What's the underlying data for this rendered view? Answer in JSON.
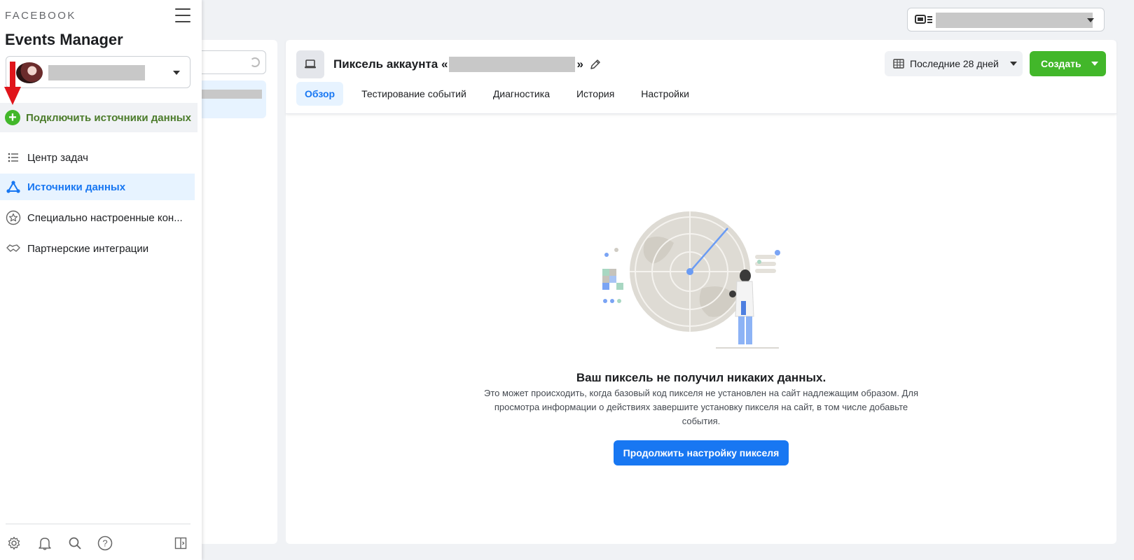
{
  "sidebar": {
    "brand": "FACEBOOK",
    "app_title": "Events Manager",
    "connect_label": "Подключить источники данных",
    "nav": [
      {
        "label": "Центр задач",
        "icon": "list-icon"
      },
      {
        "label": "Источники данных",
        "icon": "data-sources-icon",
        "active": true
      },
      {
        "label": "Специально настроенные кон...",
        "icon": "star-badge-icon"
      },
      {
        "label": "Партнерские интеграции",
        "icon": "handshake-icon"
      }
    ],
    "footer_icons": [
      "settings-icon",
      "bell-icon",
      "search-icon",
      "help-icon",
      "collapse-panel-icon"
    ]
  },
  "header": {
    "title_prefix": "Пиксель аккаунта «",
    "title_suffix": "»",
    "date_range": "Последние 28 дней",
    "create_label": "Создать"
  },
  "tabs": [
    "Обзор",
    "Тестирование событий",
    "Диагностика",
    "История",
    "Настройки"
  ],
  "empty_state": {
    "title": "Ваш пиксель не получил никаких данных.",
    "description": "Это может происходить, когда базовый код пикселя не установлен на сайт надлежащим образом. Для просмотра информации о действиях завершите установку пикселя на сайт, в том числе добавьте события.",
    "button": "Продолжить настройку пикселя"
  },
  "colors": {
    "accent_blue": "#1877f2",
    "green": "#42b72a",
    "active_bg": "#e7f3ff",
    "background": "#f0f2f5"
  }
}
